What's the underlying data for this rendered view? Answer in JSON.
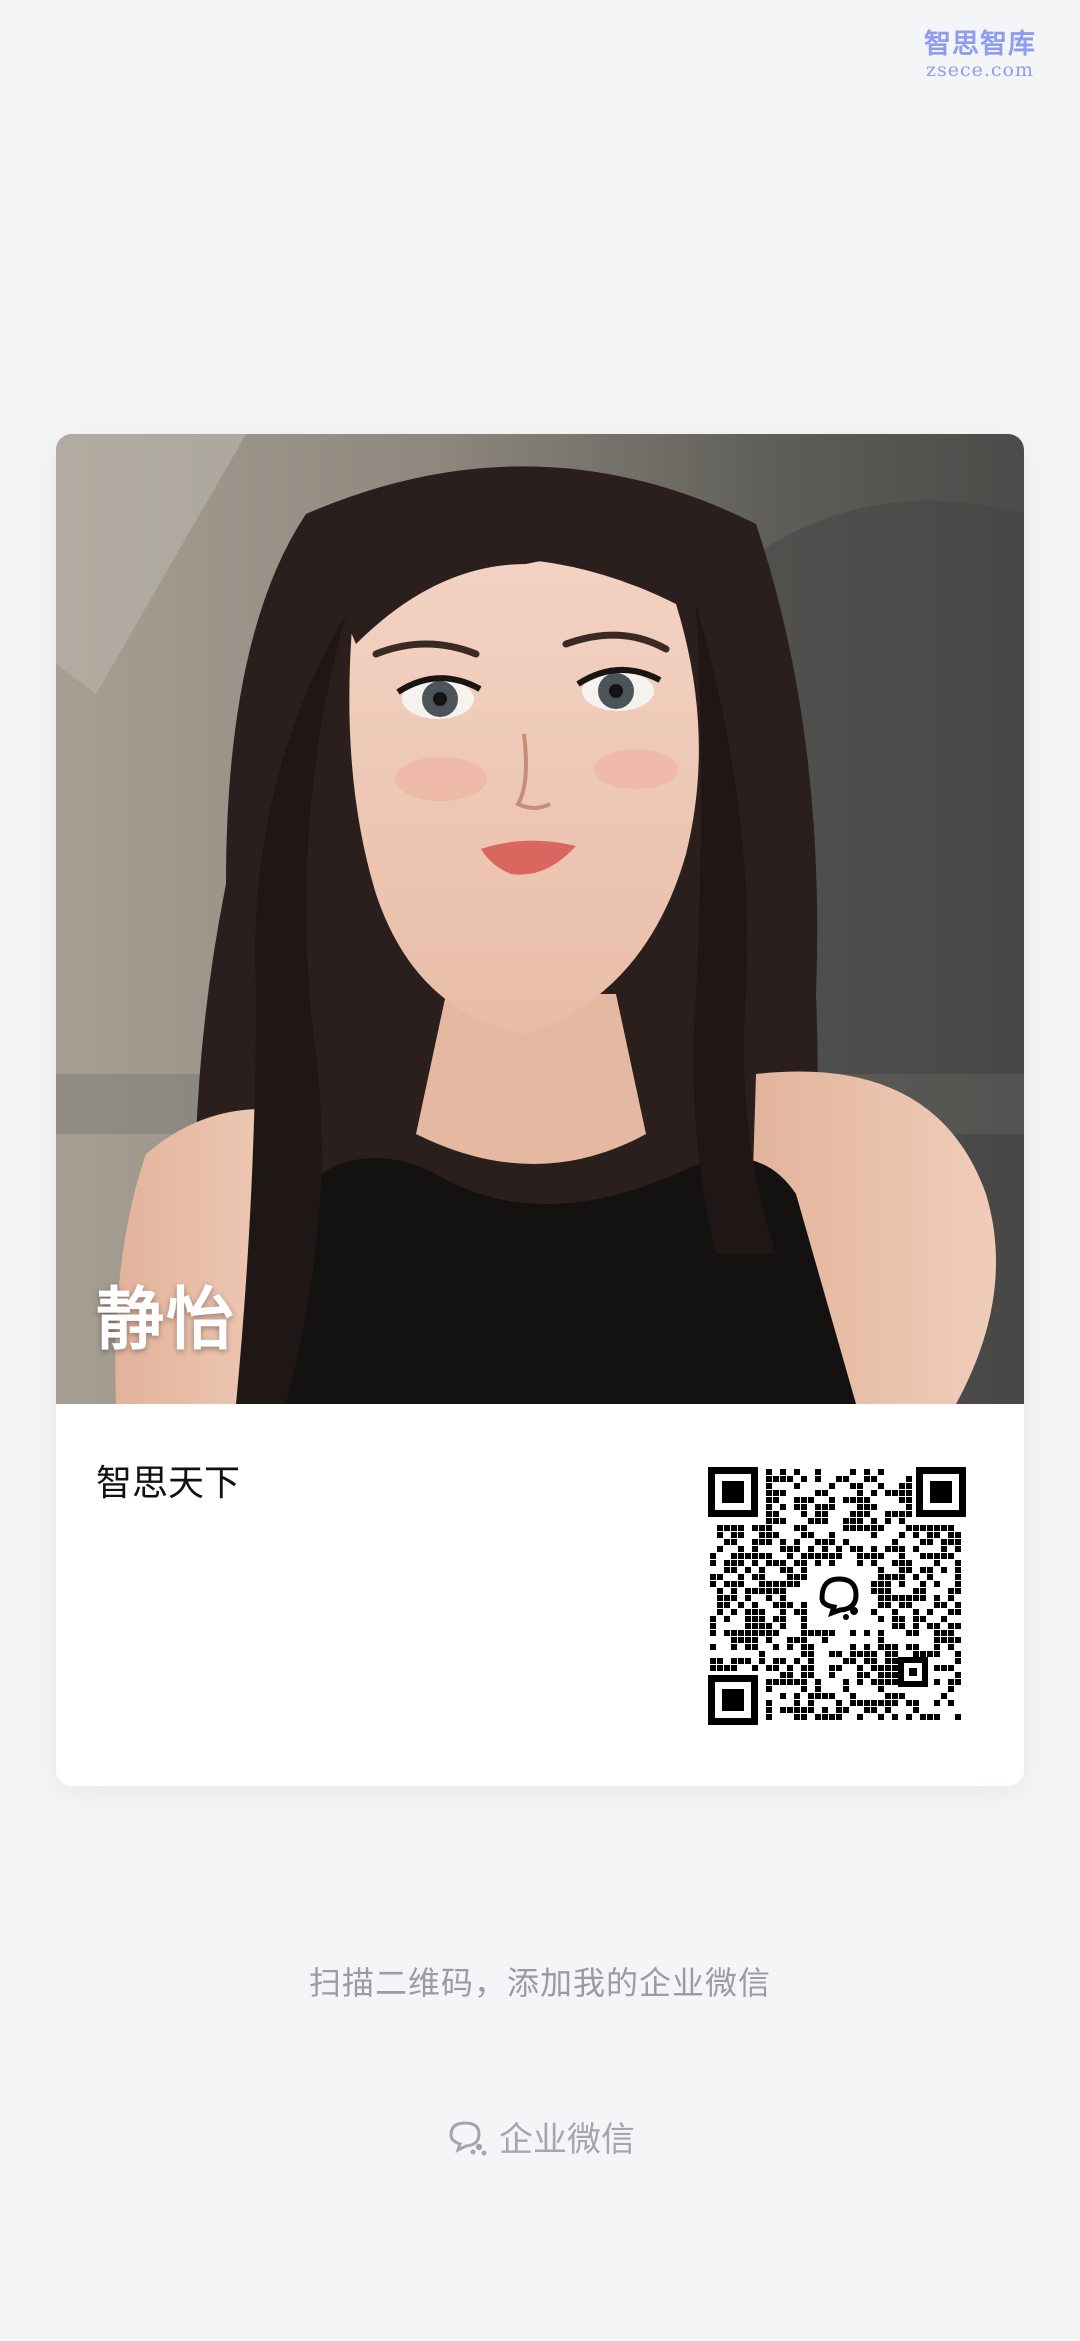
{
  "watermark": {
    "cn": "智思智库",
    "en": "zsece.com"
  },
  "card": {
    "name": "静怡",
    "company": "智思天下"
  },
  "hint": "扫描二维码，添加我的企业微信",
  "brand": {
    "label": "企业微信",
    "icon": "wecom-logo-icon"
  },
  "colors": {
    "background": "#f4f5f7",
    "card": "#ffffff",
    "hint_text": "#9a9ca3"
  }
}
